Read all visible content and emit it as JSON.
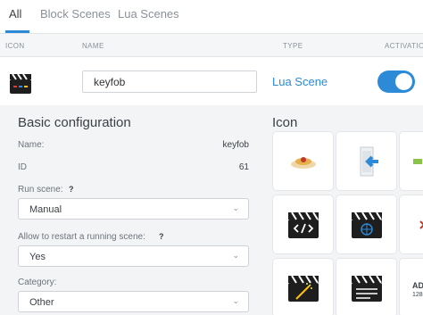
{
  "tabs": [
    {
      "label": "All"
    },
    {
      "label": "Block Scenes"
    },
    {
      "label": "Lua Scenes"
    }
  ],
  "columns": {
    "icon": "ICON",
    "name": "NAME",
    "type": "TYPE",
    "activation": "ACTIVATION"
  },
  "scene": {
    "icon": "clapperboard-icon",
    "name_value": "keyfob",
    "type": "Lua Scene",
    "activation_on": true
  },
  "config": {
    "title": "Basic configuration",
    "name_label": "Name:",
    "name_value": "keyfob",
    "id_label": "ID",
    "id_value": "61",
    "run_label": "Run scene:",
    "run_help": "?",
    "run_value": "Manual",
    "restart_label": "Allow to restart a running scene:",
    "restart_help": "?",
    "restart_value": "Yes",
    "category_label": "Category:",
    "category_value": "Other"
  },
  "icons_panel": {
    "title": "Icon",
    "items": [
      "food-plate-icon",
      "door-arrow-icon",
      "partial-icon",
      "clapperboard-code-icon",
      "clapperboard-globe-icon",
      "partial-icon",
      "clapperboard-magic-icon",
      "clapperboard-icon",
      "text-partial-icon"
    ],
    "edge_label": "AD",
    "edge_sub": "128"
  },
  "colors": {
    "accent": "#2d8ad6",
    "panel_bg": "#f3f4f6"
  }
}
